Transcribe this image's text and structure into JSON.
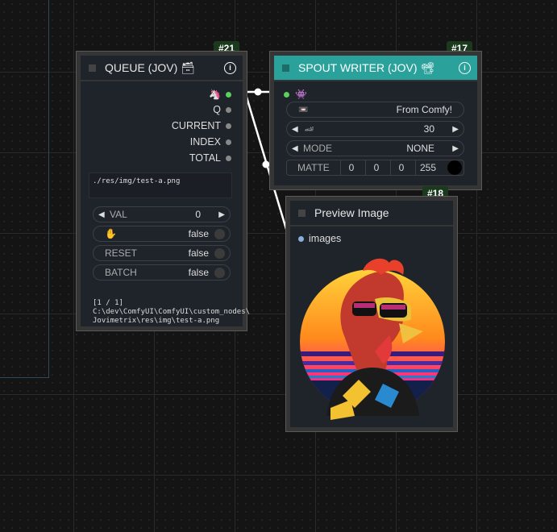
{
  "nodes": {
    "queue": {
      "badge": "#21",
      "title": "QUEUE (JOV) 🗃",
      "outputs": [
        "Q",
        "CURRENT",
        "INDEX",
        "TOTAL"
      ],
      "top_output_icon": "rainbow-unicorn-icon",
      "text_value": "./res/img/test-a.png",
      "val_label": "VAL",
      "val_value": "0",
      "hand_icon": "hand-icon",
      "hand_value": "false",
      "reset_label": "RESET",
      "reset_value": "false",
      "batch_label": "BATCH",
      "batch_value": "false",
      "status_lines": [
        "[1 / 1]",
        "C:\\dev\\ComfyUI\\ComfyUI\\custom_nodes\\",
        "Jovimetrix\\res\\img\\test-a.png"
      ]
    },
    "spout": {
      "badge": "#17",
      "title": "SPOUT WRITER (JOV) 📽",
      "header_color": "#2aa19b",
      "input_icon": "alien-monster-icon",
      "name_value": "From Comfy!",
      "fps_value": "30",
      "mode_label": "MODE",
      "mode_value": "NONE",
      "matte_label": "MATTE",
      "matte_values": [
        "0",
        "0",
        "0",
        "255"
      ]
    },
    "preview": {
      "badge": "#18",
      "title": "Preview Image",
      "input_label": "images"
    }
  },
  "colors": {
    "background": "#141414",
    "node_body": "#1f242b",
    "badge": "#1b3a1d",
    "link": "#ffffff"
  }
}
